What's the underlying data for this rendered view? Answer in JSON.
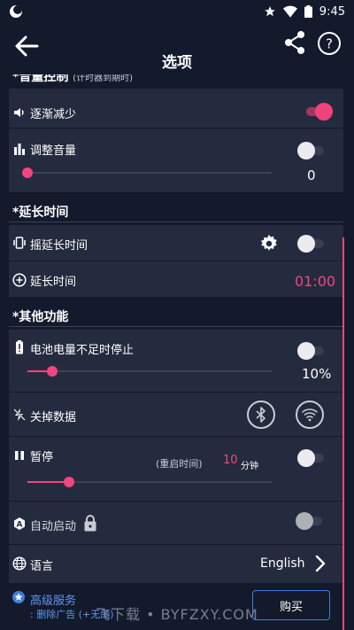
{
  "status_bar": {
    "time": "9:45"
  },
  "header": {
    "title": "选项"
  },
  "volume_section": {
    "title": "*音量控制",
    "subtitle": "(计时器到期时)"
  },
  "volume": {
    "fade_label": "逐渐减少",
    "fade_on": true,
    "adjust_label": "调整音量",
    "adjust_on": false,
    "adjust_value": "0",
    "adjust_level": 0.0
  },
  "extend_section": {
    "title": "*延长时间"
  },
  "extend": {
    "shake_label": "摇延长时间",
    "shake_on": false,
    "extend_label": "延长时间",
    "extend_value": "01:00"
  },
  "other_section": {
    "title": "*其他功能"
  },
  "other": {
    "battery_label": "电池电量不足时停止",
    "battery_on": false,
    "battery_value": "10%",
    "battery_level": 0.1,
    "data_label": "关掉数据",
    "pause_label": "暂停",
    "pause_on": false,
    "pause_restart_label": "(重启时间)",
    "pause_restart_value": "10",
    "pause_restart_unit": "分钟",
    "pause_level": 0.17,
    "autostart_label": "自动启动",
    "autostart_on": false,
    "language_label": "语言",
    "language_value": "English"
  },
  "footer": {
    "premium_label": "高级服务",
    "premium_desc": ": 删除广告 (+无颌)",
    "buy_label": "购买",
    "watermark": "飞下载 • BYFZXY.COM"
  },
  "colors": {
    "accent": "#ef4680",
    "background": "#131a2c",
    "card": "#252b3e",
    "link": "#3f7ee0"
  }
}
